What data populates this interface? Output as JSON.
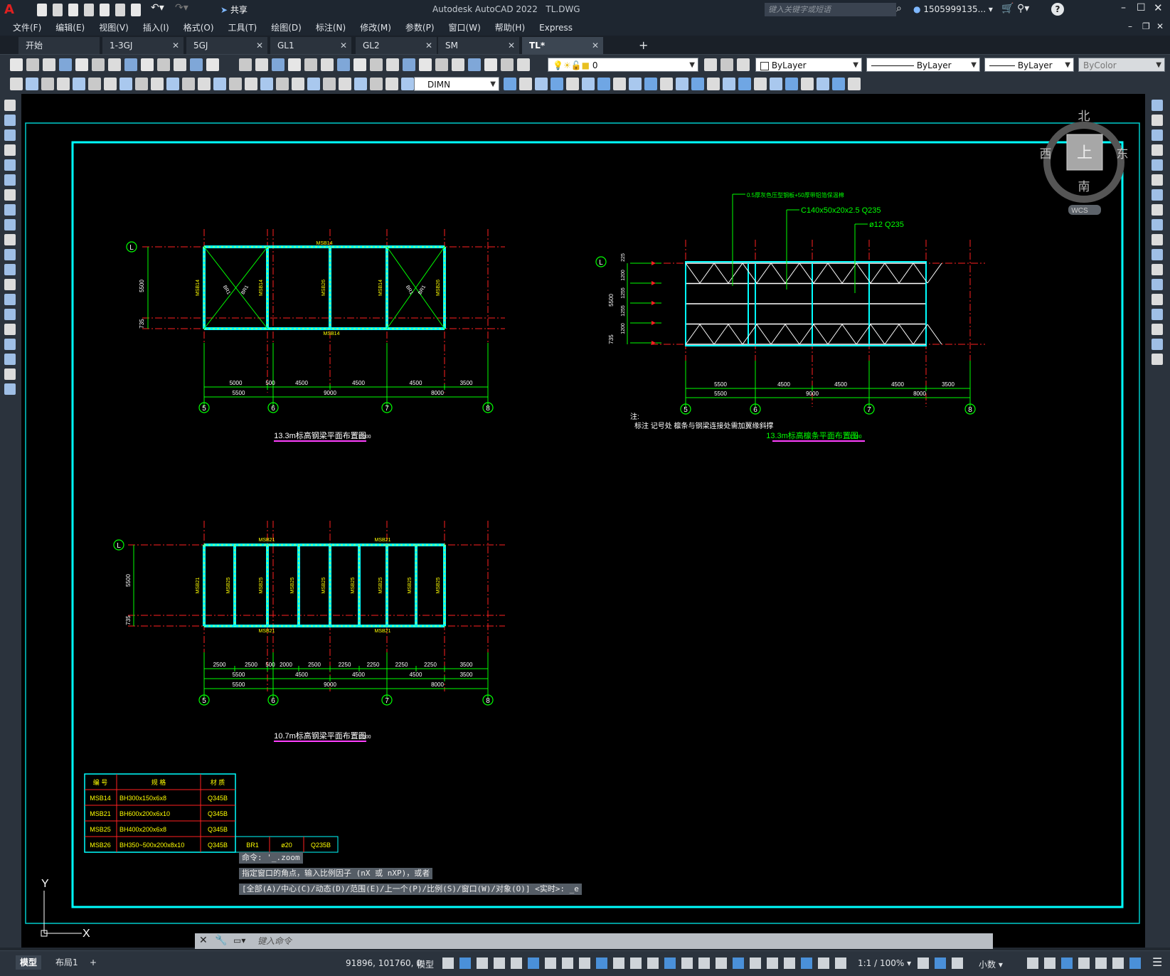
{
  "window": {
    "title": "Autodesk AutoCAD 2022",
    "file": "TL.DWG",
    "search_placeholder": "键入关键字或短语",
    "user": "1505999135...",
    "share_label": "共享",
    "app_letter": "A"
  },
  "menu": [
    "文件(F)",
    "编辑(E)",
    "视图(V)",
    "插入(I)",
    "格式(O)",
    "工具(T)",
    "绘图(D)",
    "标注(N)",
    "修改(M)",
    "参数(P)",
    "窗口(W)",
    "帮助(H)",
    "Express"
  ],
  "tabs": [
    {
      "label": "开始",
      "closable": false
    },
    {
      "label": "1-3GJ",
      "closable": true
    },
    {
      "label": "5GJ",
      "closable": true
    },
    {
      "label": "GL1",
      "closable": true
    },
    {
      "label": "GL2",
      "closable": true
    },
    {
      "label": "SM",
      "closable": true
    },
    {
      "label": "TL*",
      "closable": true,
      "active": true
    }
  ],
  "toolbar": {
    "layer_value": "0",
    "color": "ByLayer",
    "linetype": "ByLayer",
    "lineweight": "ByLayer",
    "plotstyle": "ByColor",
    "dimstyle": "DIMN"
  },
  "viewcube": {
    "north": "北",
    "south": "南",
    "east": "东",
    "west": "西",
    "top": "上",
    "wcs": "WCS"
  },
  "drawing": {
    "plan1": {
      "title": "13.3m标高钢梁平面布置图",
      "scale": "1:100",
      "axis_row": "L",
      "axes": [
        "5",
        "6",
        "7",
        "8"
      ],
      "dims_row1": [
        "5000",
        "500",
        "4500",
        "4500",
        "4500",
        "3500"
      ],
      "dims_row2": [
        "5500",
        "9000",
        "8000"
      ],
      "side_dims": [
        "5500",
        "735"
      ],
      "beam_top": "MSB14",
      "beam_bottom": "MSB14",
      "verticals": [
        "MSB14",
        "MSB14",
        "MSB26",
        "MSB14",
        "MSB26"
      ],
      "brace": "BR1"
    },
    "plan2": {
      "title": "13.3m标高檩条平面布置图",
      "scale": "1:100",
      "axis_row": "L",
      "axes": [
        "5",
        "6",
        "7",
        "8"
      ],
      "dims_row1": [
        "5500",
        "4500",
        "4500",
        "4500",
        "3500"
      ],
      "dims_row2": [
        "5500",
        "9000",
        "8000"
      ],
      "side_dims": [
        "5500",
        "735",
        "225",
        "1200",
        "1255",
        "1255",
        "1200"
      ],
      "callouts": [
        "0.5厚灰色压型钢板+50厚带铝箔保温棉",
        "C140x50x20x2.5 Q235",
        "ø12 Q235"
      ],
      "note_title": "注:",
      "note_text": "标注 记号处 檩条与钢梁连接处需加翼缘斜撑"
    },
    "plan3": {
      "title": "10.7m标高钢梁平面布置图",
      "scale": "1:100",
      "axis_row": "L",
      "axes": [
        "5",
        "6",
        "7",
        "8"
      ],
      "dims_row1": [
        "2500",
        "2500",
        "500",
        "2000",
        "2500",
        "2250",
        "2250",
        "2250",
        "2250",
        "3500"
      ],
      "dims_row2": [
        "5500",
        "4500",
        "4500",
        "4500",
        "3500"
      ],
      "dims_row3": [
        "5500",
        "9000",
        "8000"
      ],
      "side_dims": [
        "5500",
        "735"
      ],
      "beam_top": "MSB21",
      "beam_bottom": "MSB21",
      "verticals": [
        "MSB21",
        "MSB25",
        "MSB25",
        "MSB25",
        "MSB25",
        "MSB25",
        "MSB25",
        "MSB25",
        "MSB25"
      ]
    },
    "table": {
      "headers": [
        "编 号",
        "规 格",
        "材 质"
      ],
      "rows": [
        [
          "MSB14",
          "BH300x150x6x8",
          "Q345B"
        ],
        [
          "MSB21",
          "BH600x200x6x10",
          "Q345B"
        ],
        [
          "MSB25",
          "BH400x200x6x8",
          "Q345B"
        ],
        [
          "MSB26",
          "BH350~500x200x8x10",
          "Q345B"
        ]
      ],
      "extra": [
        "BR1",
        "ø20",
        "Q235B"
      ]
    },
    "ucs": {
      "x": "X",
      "y": "Y"
    }
  },
  "command": {
    "history": [
      "命令: '_.zoom",
      "指定窗口的角点，输入比例因子 (nX 或 nXP)，或者",
      "[全部(A)/中心(C)/动态(D)/范围(E)/上一个(P)/比例(S)/窗口(W)/对象(O)] <实时>: _e"
    ],
    "placeholder": "键入命令"
  },
  "status": {
    "layout_tabs": [
      "模型",
      "布局1"
    ],
    "coords": "91896, 101760, 0",
    "model_label": "模型",
    "scale": "1:1 / 100%",
    "units": "小数"
  },
  "colors": {
    "green": "#00ff00",
    "red": "#ff2020",
    "yellow": "#ffff00",
    "cyan": "#00ffff",
    "magenta": "#ff40ff",
    "white": "#ffffff"
  }
}
